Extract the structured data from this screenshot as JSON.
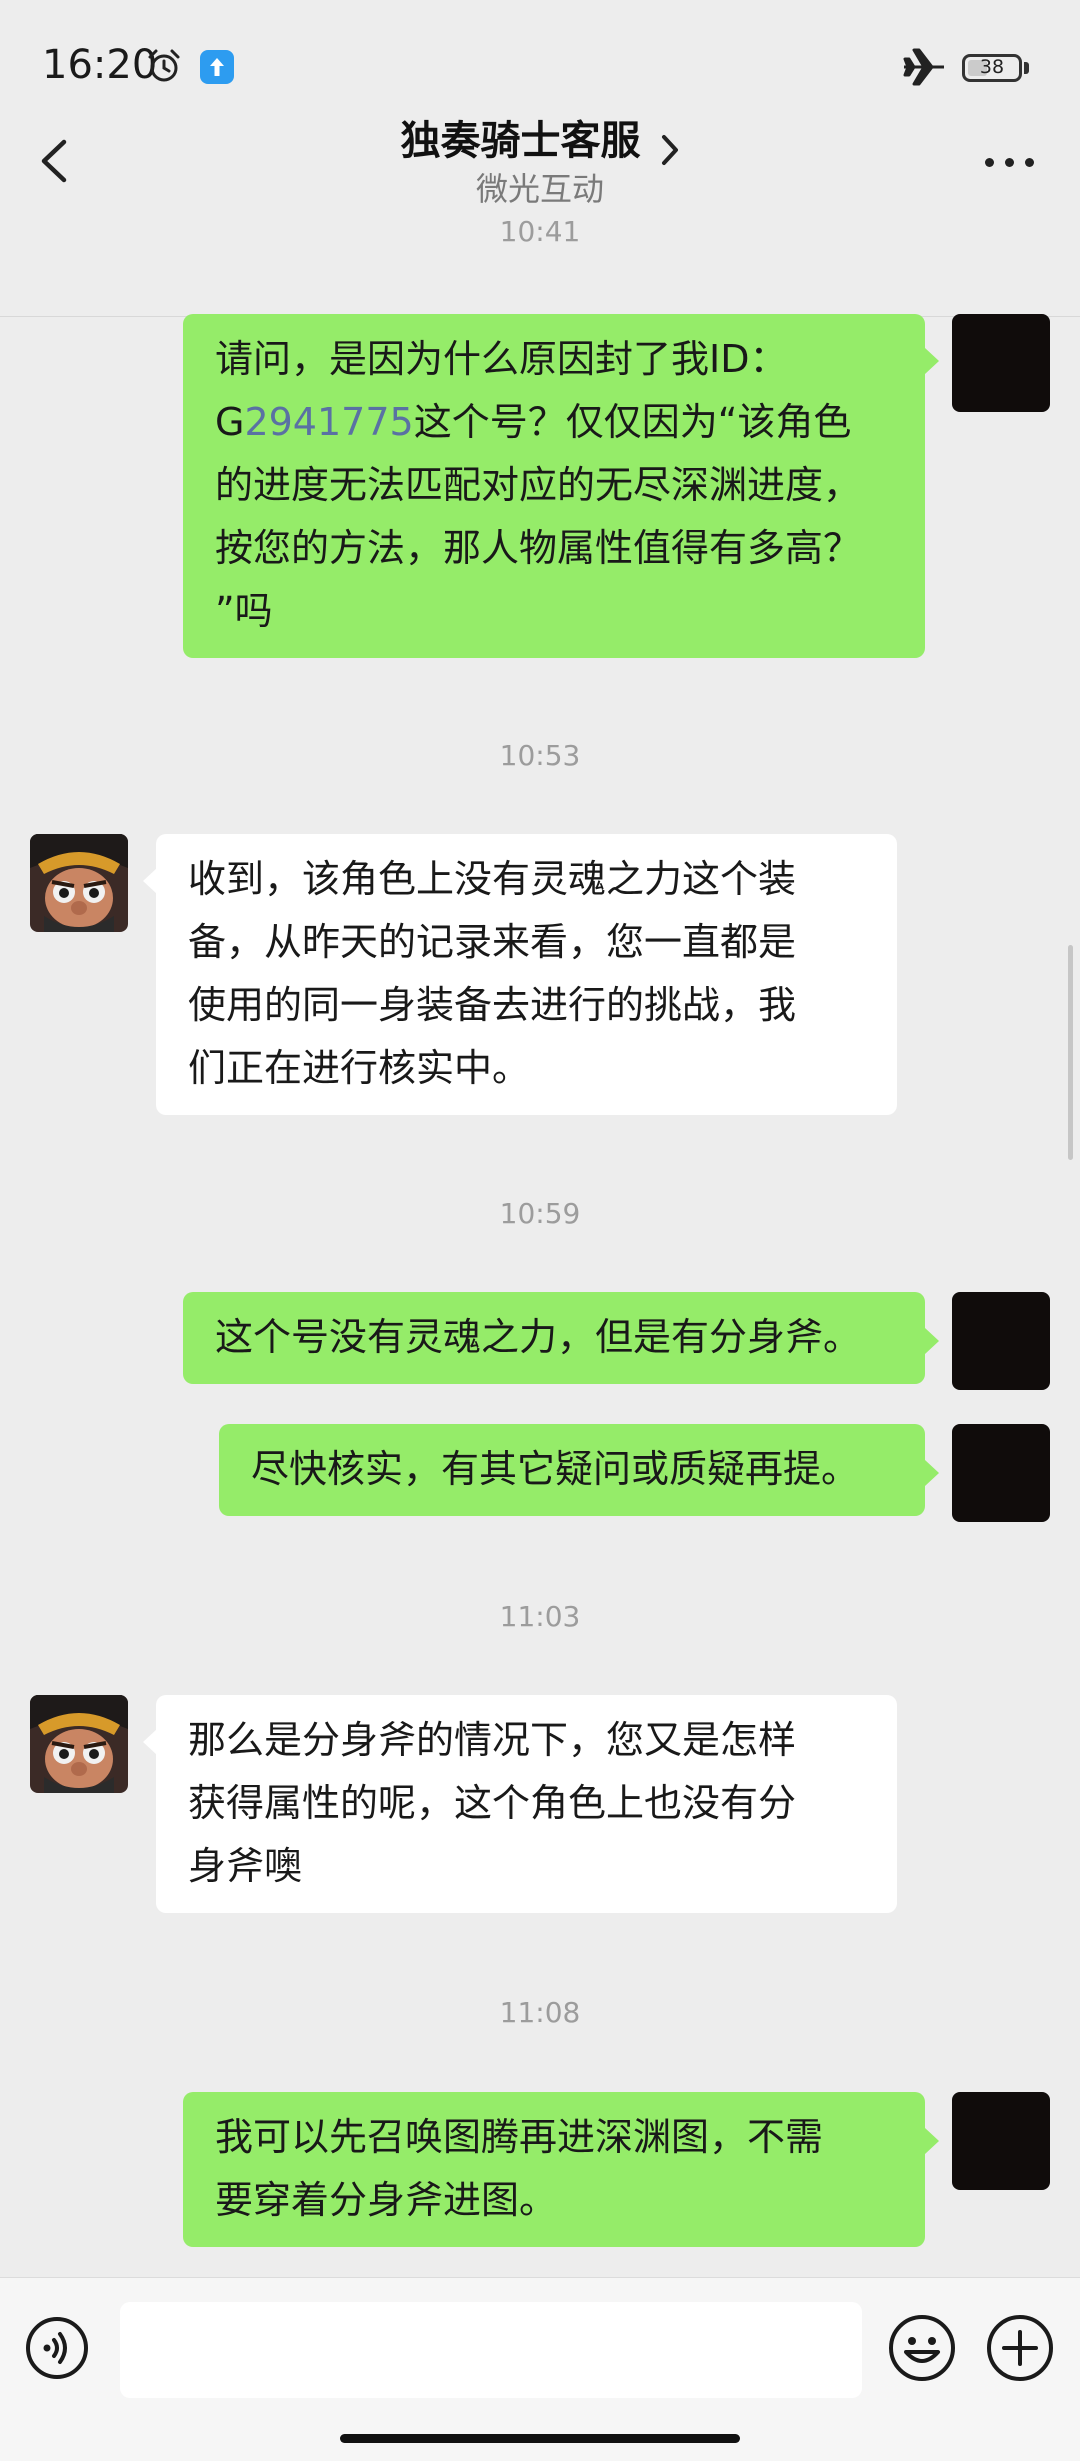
{
  "status_bar": {
    "time": "16:20",
    "battery": "38",
    "icons": [
      "alarm-icon",
      "upload-app-icon",
      "airplane-mode-icon",
      "battery-icon"
    ]
  },
  "header": {
    "title": "独奏骑士客服",
    "subtitle": "微光互动",
    "icons": [
      "back-arrow-icon",
      "chevron-right-icon",
      "more-icon"
    ]
  },
  "colors": {
    "background": "#ededed",
    "outgoing_bubble": "#95ec69",
    "incoming_bubble": "#ffffff",
    "id_link": "#5a71a3"
  },
  "messages": [
    {
      "type": "timestamp",
      "text": "10:41"
    },
    {
      "type": "outgoing",
      "parts": [
        "请问，是因为什么原因封了我ID：\nG",
        "2941775",
        "这个号？仅仅因为“该角色\n的进度无法匹配对应的无尽深渊进度，\n按您的方法，那人物属性值得有多高？\n”吗"
      ]
    },
    {
      "type": "timestamp",
      "text": "10:53"
    },
    {
      "type": "incoming",
      "text": "收到，该角色上没有灵魂之力这个装\n备，从昨天的记录来看，您一直都是\n使用的同一身装备去进行的挑战，我\n们正在进行核实中。"
    },
    {
      "type": "timestamp",
      "text": "10:59"
    },
    {
      "type": "outgoing",
      "text": "这个号没有灵魂之力，但是有分身斧。"
    },
    {
      "type": "outgoing",
      "text": "尽快核实，有其它疑问或质疑再提。"
    },
    {
      "type": "timestamp",
      "text": "11:03"
    },
    {
      "type": "incoming",
      "text": "那么是分身斧的情况下，您又是怎样\n获得属性的呢，这个角色上也没有分\n身斧噢"
    },
    {
      "type": "timestamp",
      "text": "11:08"
    },
    {
      "type": "outgoing",
      "text": "我可以先召唤图腾再进深渊图，不需\n要穿着分身斧进图。"
    }
  ],
  "input_bar": {
    "value": "",
    "icons": [
      "voice-icon",
      "emoji-icon",
      "plus-icon"
    ]
  }
}
